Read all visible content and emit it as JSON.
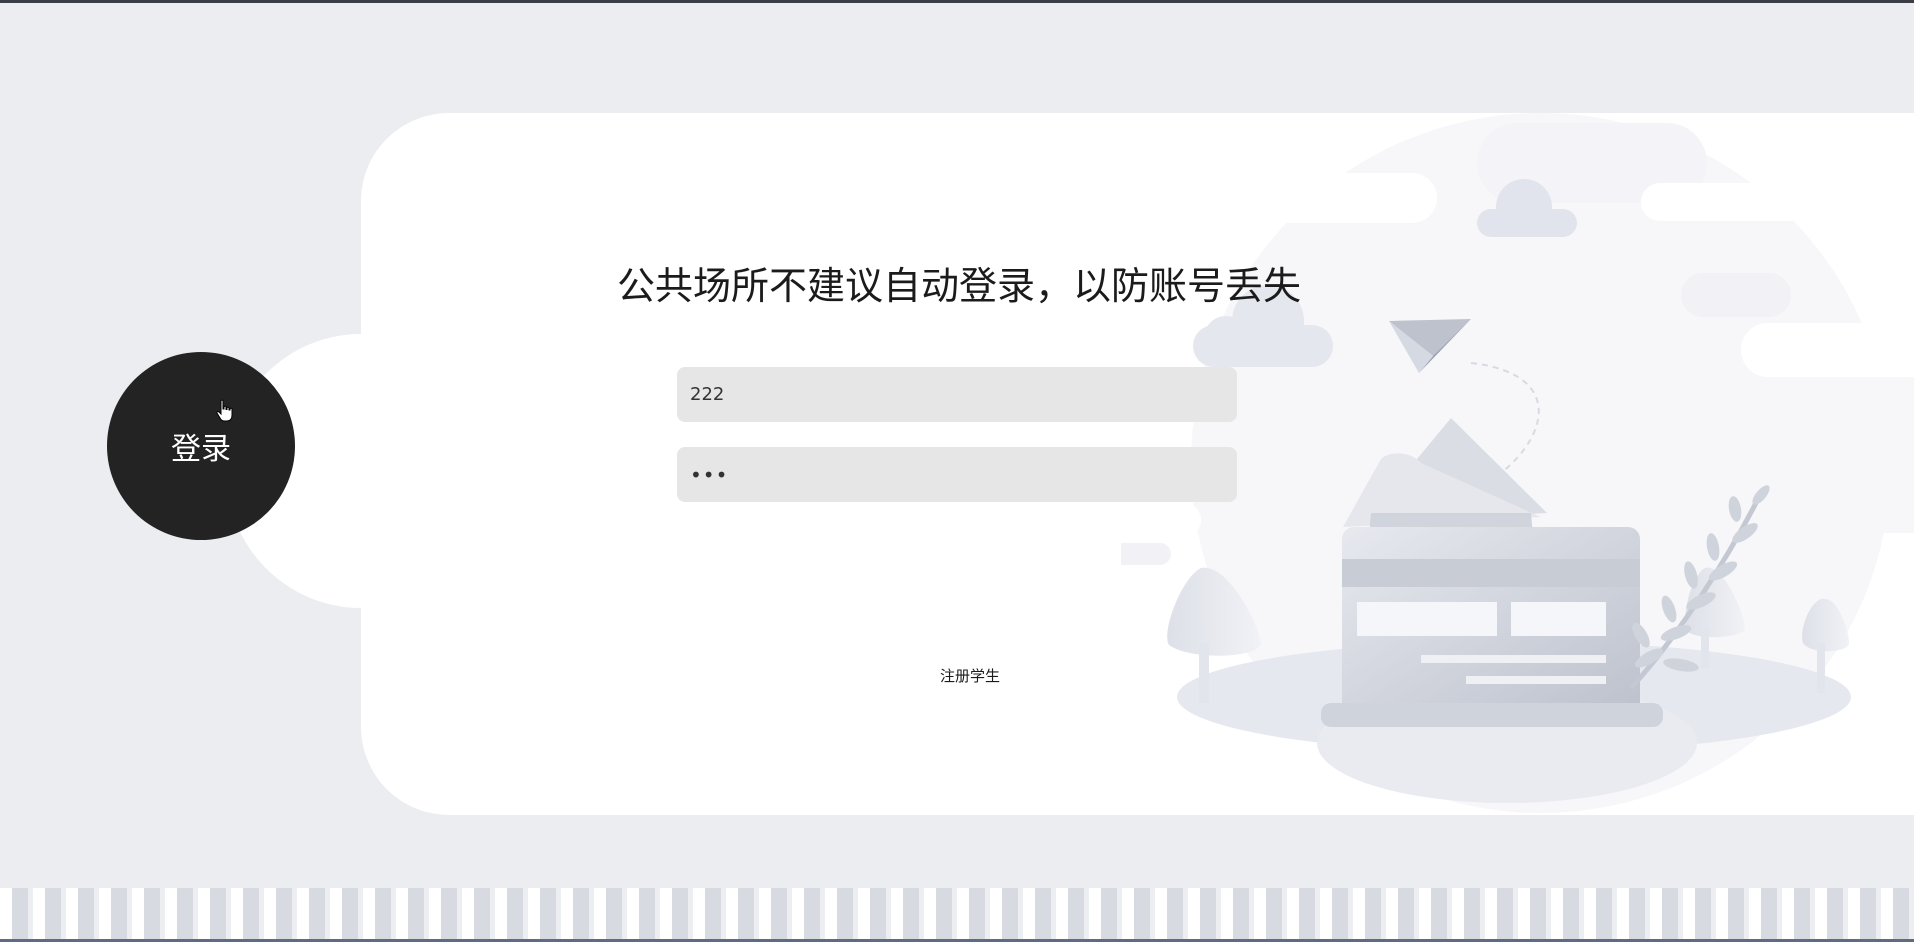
{
  "login": {
    "title": "公共场所不建议自动登录，以防账号丢失",
    "username_value": "222",
    "password_value": "•••",
    "login_label": "登录",
    "register_label": "注册学生"
  },
  "colors": {
    "page_background": "#ecedf1",
    "card": "#ffffff",
    "login_button": "#232323",
    "input_background": "#e6e6e6",
    "illustration": "#d3d7e0"
  },
  "icons": [
    "cursor-hand-icon",
    "paper-plane-icon",
    "cloud-icon",
    "wallet-card-icon",
    "plant-icon",
    "tree-icon"
  ]
}
